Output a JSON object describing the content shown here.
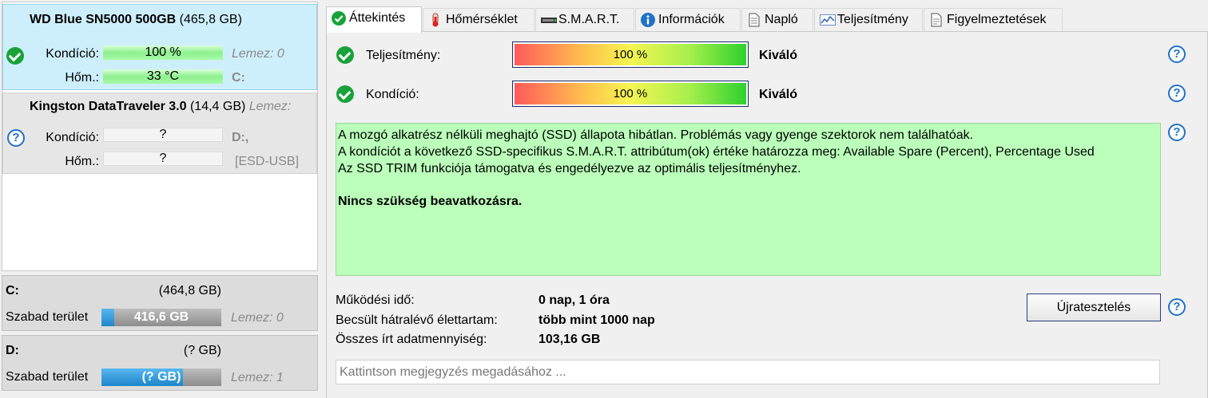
{
  "colors": {
    "selected_disk_bg": "#cdeffc",
    "ok_green": "#1aa23a",
    "help_blue": "#1f73c8",
    "desc_bg": "#bbffbb",
    "volume_bar": "#1d86cb"
  },
  "disks": [
    {
      "model": "WD Blue SN5000 500GB",
      "capacity": "(465,8 GB)",
      "status_icon": "check-circle-icon",
      "condition_label": "Kondíció:",
      "condition_value": "100 %",
      "temp_label": "Hőm.:",
      "temp_value": "33 °C",
      "disk_index": "Lemez: 0",
      "drive_letter": "C:"
    },
    {
      "model": "Kingston DataTraveler 3.0",
      "capacity": "(14,4 GB)",
      "disk_index": "Lemez:",
      "status_icon": "question-circle-icon",
      "condition_label": "Kondíció:",
      "condition_value": "?",
      "temp_label": "Hőm.:",
      "temp_value": "?",
      "drive_letter": "D:,",
      "drive_extra": "[ESD-USB]"
    }
  ],
  "volumes": [
    {
      "name": "C:",
      "size": "(464,8 GB)",
      "free_label": "Szabad terület",
      "free_value": "416,6 GB",
      "used_fraction": 0.104,
      "disk": "Lemez: 0"
    },
    {
      "name": "D:",
      "size": "(? GB)",
      "free_label": "Szabad terület",
      "free_value": "(? GB)",
      "used_fraction": 0.68,
      "disk": "Lemez: 1"
    }
  ],
  "tabs": [
    {
      "label": "Áttekintés",
      "icon": "check-circle-icon",
      "active": true
    },
    {
      "label": "Hőmérséklet",
      "icon": "thermometer-icon"
    },
    {
      "label": "S.M.A.R.T.",
      "icon": "drive-icon"
    },
    {
      "label": "Információk",
      "icon": "info-icon"
    },
    {
      "label": "Napló",
      "icon": "document-icon"
    },
    {
      "label": "Teljesítmény",
      "icon": "chart-icon"
    },
    {
      "label": "Figyelmeztetések",
      "icon": "warning-doc-icon"
    }
  ],
  "overview": {
    "performance_label": "Teljesítmény:",
    "performance_value": "100 %",
    "performance_fraction": 1.0,
    "performance_rating": "Kiváló",
    "condition_label": "Kondíció:",
    "condition_value": "100 %",
    "condition_fraction": 1.0,
    "condition_rating": "Kiváló",
    "description": {
      "line1": "A mozgó alkatrész nélküli meghajtó (SSD) állapota hibátlan. Problémás vagy gyenge szektorok nem találhatóak.",
      "line2": "A kondíciót a következő SSD-specifikus S.M.A.R.T. attribútum(ok) értéke határozza meg:  Available Spare (Percent), Percentage Used",
      "line3": "Az SSD TRIM funkciója támogatva és engedélyezve az optimális teljesítményhez.",
      "action": "Nincs szükség beavatkozásra."
    },
    "uptime_label": "Működési idő:",
    "uptime_value": "0 nap, 1 óra",
    "lifetime_label": "Becsült hátralévő élettartam:",
    "lifetime_value": "több mint 1000 nap",
    "written_label": "Összes írt adatmennyiség:",
    "written_value": "103,16 GB",
    "retest_button": "Újratesztelés",
    "note_placeholder": "Kattintson megjegyzés megadásához ..."
  }
}
